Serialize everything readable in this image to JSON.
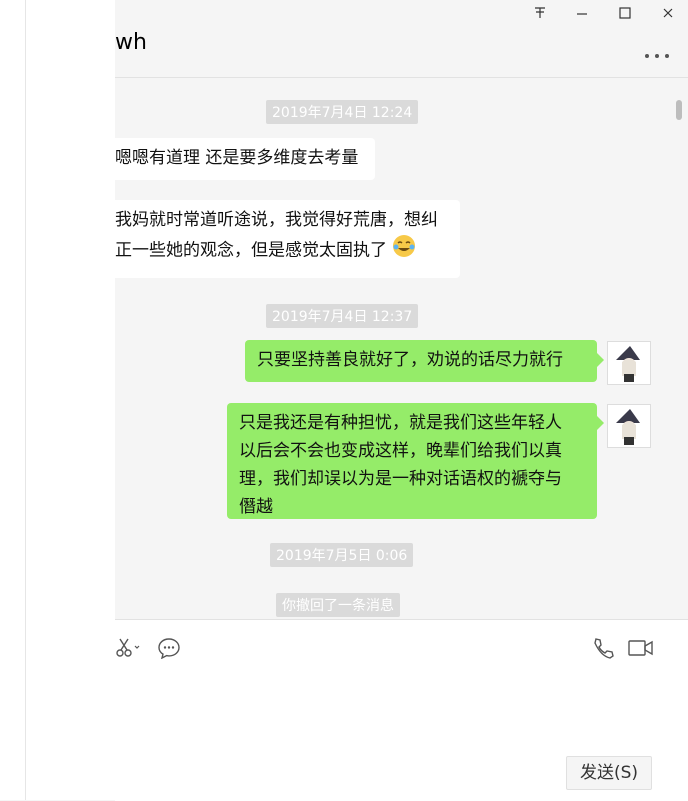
{
  "window": {
    "chat_title": "wh",
    "pin_icon": "pin-icon",
    "minimize_icon": "minimize-icon",
    "maximize_icon": "maximize-icon",
    "close_icon": "close-icon",
    "more_icon": "more-icon"
  },
  "messages": [
    {
      "type": "timestamp",
      "text": "2019年7月4日 12:24"
    },
    {
      "type": "incoming",
      "text": "嗯嗯有道理 还是要多维度去考量"
    },
    {
      "type": "incoming",
      "lines": [
        "我妈就时常道听途说，我觉得好荒唐，想纠",
        "正一些她的观念，但是感觉太固执了"
      ],
      "emoji": "laughing-crying-emoji"
    },
    {
      "type": "timestamp",
      "text": "2019年7月4日 12:37"
    },
    {
      "type": "outgoing",
      "text": "只要坚持善良就好了，劝说的话尽力就行"
    },
    {
      "type": "outgoing",
      "lines": [
        "只是我还是有种担忧，就是我们这些年轻人",
        "以后会不会也变成这样，晚辈们给我们以真",
        "理，我们却误以为是一种对话语权的褫夺与",
        "僭越"
      ]
    },
    {
      "type": "timestamp",
      "text": "2019年7月5日 0:06"
    },
    {
      "type": "system",
      "text": "你撤回了一条消息"
    }
  ],
  "composer": {
    "send_label": "发送(S)",
    "tools": [
      "scissors-icon",
      "chat-bubble-icon",
      "phone-icon",
      "video-icon"
    ]
  }
}
